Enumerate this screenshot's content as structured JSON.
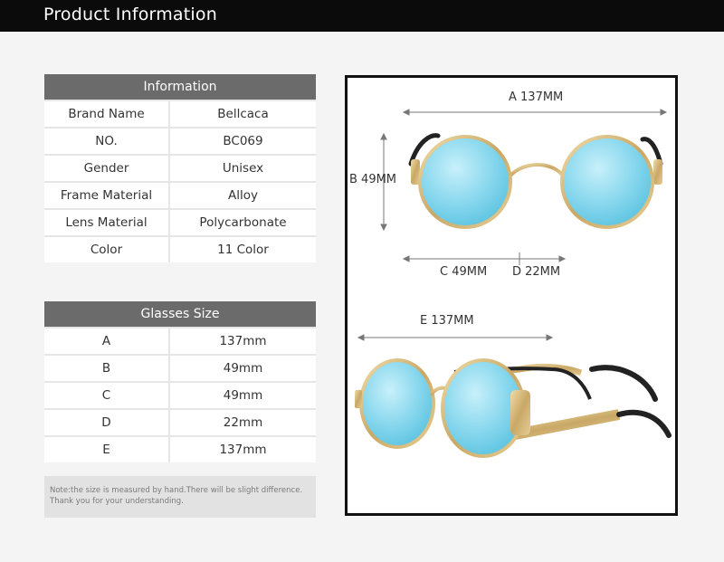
{
  "header": {
    "title": "Product Information"
  },
  "info": {
    "title": "Information",
    "rows": [
      {
        "label": "Brand Name",
        "value": "Bellcaca"
      },
      {
        "label": "NO.",
        "value": "BC069"
      },
      {
        "label": "Gender",
        "value": "Unisex"
      },
      {
        "label": "Frame Material",
        "value": "Alloy"
      },
      {
        "label": "Lens Material",
        "value": "Polycarbonate"
      },
      {
        "label": "Color",
        "value": "11 Color"
      }
    ]
  },
  "size": {
    "title": "Glasses Size",
    "rows": [
      {
        "label": "A",
        "value": "137mm"
      },
      {
        "label": "B",
        "value": "49mm"
      },
      {
        "label": "C",
        "value": "49mm"
      },
      {
        "label": "D",
        "value": "22mm"
      },
      {
        "label": "E",
        "value": "137mm"
      }
    ]
  },
  "note": {
    "line1": "Note:the size is measured by hand.There will be slight difference.",
    "line2": "Thank you for your understanding."
  },
  "dimensions": {
    "a": "A 137MM",
    "b": "B 49MM",
    "c": "C 49MM",
    "d": "D 22MM",
    "e": "E 137MM"
  },
  "colors": {
    "lens": "#8ad8ee",
    "frame": "#d4b77a",
    "header_bg": "#0b0b0b",
    "table_head": "#6b6b6b"
  }
}
